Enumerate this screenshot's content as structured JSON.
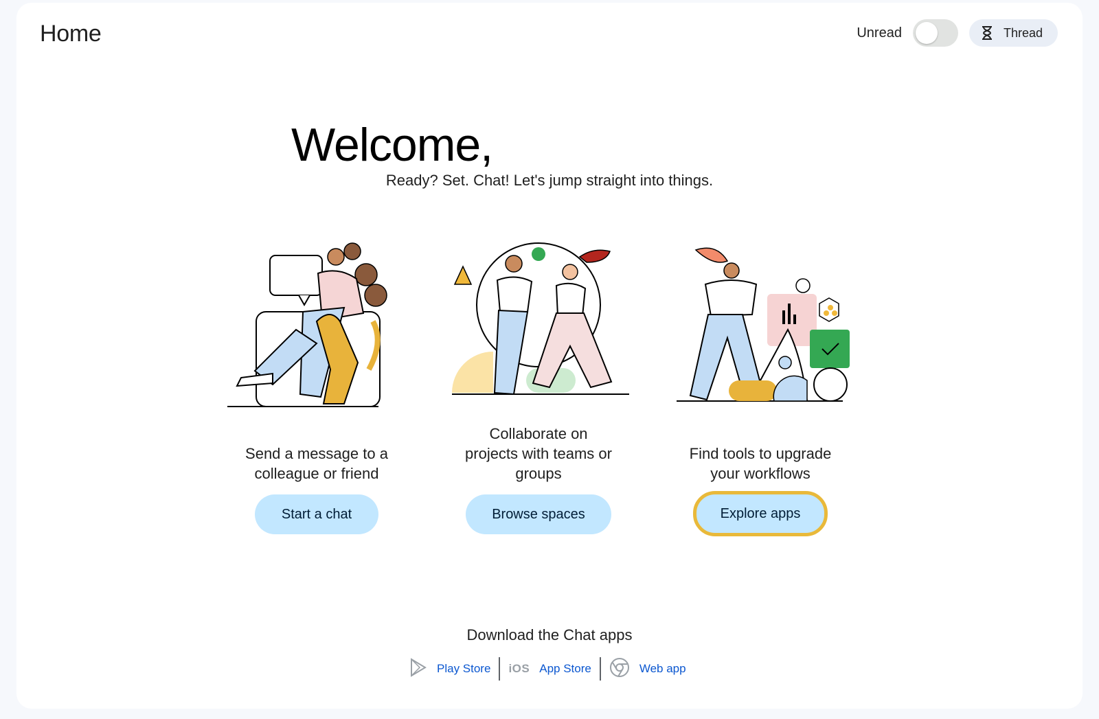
{
  "header": {
    "title": "Home",
    "unread_label": "Unread",
    "unread_on": false,
    "thread_label": "Thread"
  },
  "hero": {
    "title": "Welcome,",
    "subtitle": "Ready? Set. Chat! Let's jump straight into things."
  },
  "cards": [
    {
      "line1": "Send a message to a",
      "line2": "colleague or friend",
      "line3": "",
      "button": "Start a chat"
    },
    {
      "line1": "Collaborate on",
      "line2": "projects with teams or",
      "line3": "groups",
      "button": "Browse spaces"
    },
    {
      "line1": "Find tools to upgrade",
      "line2": "your workflows",
      "line3": "",
      "button": "Explore apps"
    }
  ],
  "download": {
    "title": "Download the Chat apps",
    "play_store": "Play Store",
    "ios_mark": "iOS",
    "app_store": "App Store",
    "web_app": "Web app"
  },
  "colors": {
    "accent_button": "#c2e7ff",
    "focus_ring": "#e9b93a",
    "link": "#0b57d0"
  }
}
